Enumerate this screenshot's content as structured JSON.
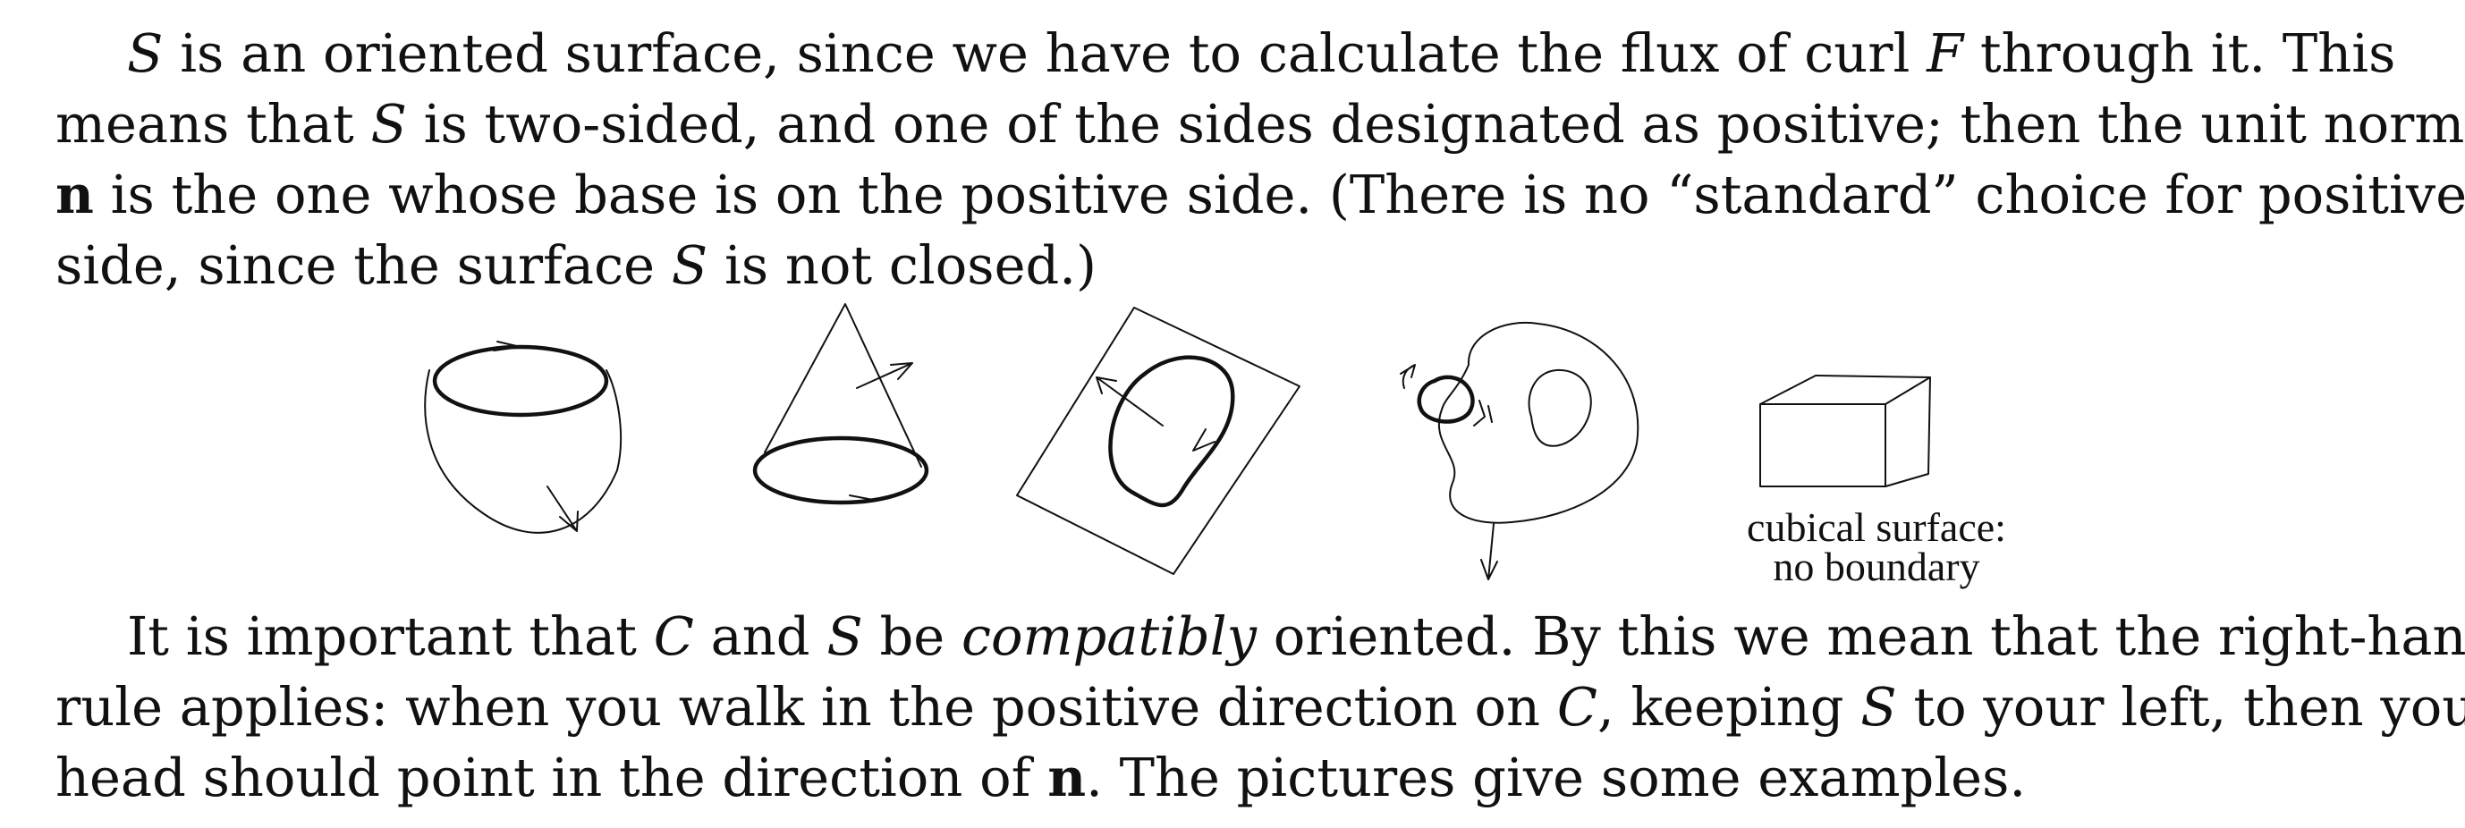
{
  "paragraph1": {
    "l1_var": "S",
    "l1_a": "is an oriented surface, since we have to calculate the flux of curl",
    "l1_var2": "F",
    "l1_b": "through it.  This",
    "l2_a": "means that",
    "l2_var": "S",
    "l2_b": "is two-sided, and one of the sides designated as positive; then the unit normal",
    "l3_bold": "n",
    "l3_a": "is the one whose base is on the positive side. (There is no “standard” choice for positive",
    "l4_a": "side, since the surface",
    "l4_var": "S",
    "l4_b": "is not closed.)"
  },
  "figures": {
    "caption_line1": "cubical surface:",
    "caption_line2": "no boundary"
  },
  "paragraph2": {
    "l1_a": "It is important that",
    "l1_var1": "C",
    "l1_b": "and",
    "l1_var2": "S",
    "l1_c": "be",
    "l1_em": "compatibly",
    "l1_d": "oriented.  By this we mean that the right-hand",
    "l2_a": "rule applies: when you walk in the positive direction on",
    "l2_var1": "C",
    "l2_b": ", keeping",
    "l2_var2": "S",
    "l2_c": "to your left, then your",
    "l3_a": "head should point in the direction of",
    "l3_bold": "n",
    "l3_b": ".  The pictures give some examples."
  }
}
